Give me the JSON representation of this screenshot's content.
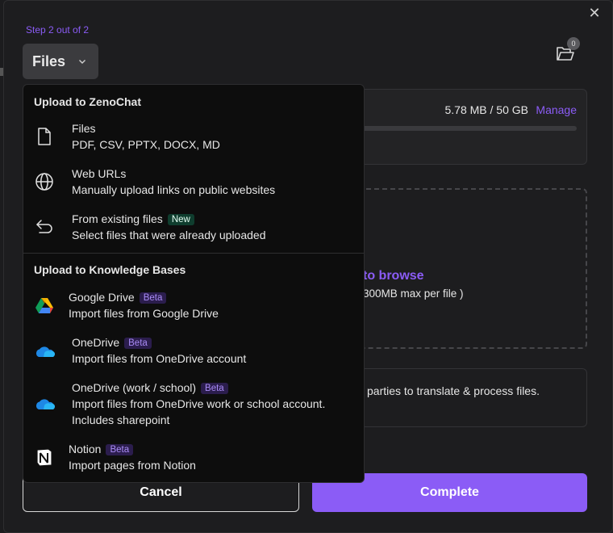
{
  "header": {
    "step": "Step 2 out of 2",
    "files_button": "Files",
    "folder_badge": "0"
  },
  "storage": {
    "usage": "5.78 MB / 50 GB",
    "manage": "Manage"
  },
  "dropzone": {
    "browse": "to browse",
    "limit": "300MB max per file )"
  },
  "notice": {
    "text": "parties to translate & process files."
  },
  "footer": {
    "cancel": "Cancel",
    "complete": "Complete"
  },
  "menu": {
    "section_zenochat": "Upload to ZenoChat",
    "section_kb": "Upload to Knowledge Bases",
    "items": [
      {
        "title": "Files",
        "desc": "PDF, CSV, PPTX, DOCX, MD"
      },
      {
        "title": "Web URLs",
        "desc": "Manually upload links on public websites"
      },
      {
        "title": "From existing files",
        "badge": "New",
        "desc": "Select files that were already uploaded"
      },
      {
        "title": "Google Drive",
        "badge": "Beta",
        "desc": "Import files from Google Drive"
      },
      {
        "title": "OneDrive",
        "badge": "Beta",
        "desc": "Import files from OneDrive account"
      },
      {
        "title": "OneDrive (work / school)",
        "badge": "Beta",
        "desc": "Import files from OneDrive work or school account.",
        "desc2": "Includes sharepoint"
      },
      {
        "title": "Notion",
        "badge": "Beta",
        "desc": "Import pages from Notion"
      }
    ]
  },
  "colors": {
    "accent": "#8b5cf6",
    "background": "#1d1d1f",
    "menu_background": "#0d0d0d"
  }
}
